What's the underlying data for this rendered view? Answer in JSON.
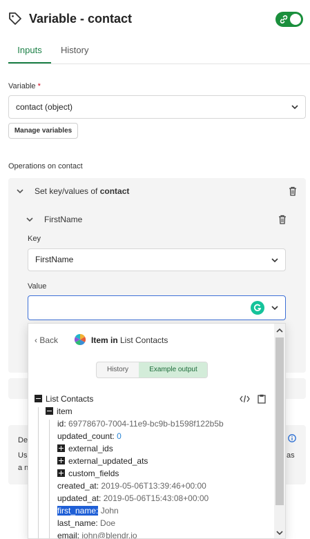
{
  "header": {
    "title": "Variable - contact"
  },
  "tabs": [
    {
      "label": "Inputs"
    },
    {
      "label": "History"
    }
  ],
  "variable": {
    "label": "Variable",
    "required_mark": "*",
    "selected": "contact (object)",
    "manage_label": "Manage variables"
  },
  "operations": {
    "heading": "Operations on contact",
    "set_prefix": "Set key/values of ",
    "set_target": "contact",
    "field_name": "FirstName",
    "key_label": "Key",
    "key_value": "FirstName",
    "value_label": "Value",
    "value_input": ""
  },
  "picker": {
    "back_label": "Back",
    "title_bold": "Item in",
    "title_rest": " List Contacts",
    "seg_history": "History",
    "seg_example": "Example output",
    "tree": {
      "root": "List Contacts",
      "item": "item",
      "id_key": "id:",
      "id_val": "69778670-7004-11e9-bc9b-b1598f122b5b",
      "updated_count_key": "updated_count:",
      "updated_count_val": "0",
      "external_ids": "external_ids",
      "external_updated_ats": "external_updated_ats",
      "custom_fields": "custom_fields",
      "created_at_key": "created_at:",
      "created_at_val": "2019-05-06T13:39:46+00:00",
      "updated_at_key": "updated_at:",
      "updated_at_val": "2019-05-06T15:43:08+00:00",
      "first_name_key": "first_name:",
      "first_name_val": "John",
      "last_name_key": "last_name:",
      "last_name_val": "Doe",
      "email_key": "email:",
      "email_val": "john@blendr.io"
    }
  },
  "description": {
    "label_fragment": "Des",
    "line1_start": "Use",
    "line1_end": "as",
    "line2_start": "a n"
  },
  "colors": {
    "accent_green": "#1a8f3c",
    "active_tab": "#1a7f45",
    "focus_blue": "#3c6fd6",
    "selection_blue": "#1f5fd6",
    "number_blue": "#2a86d6",
    "panel_gray": "#f4f4f4"
  }
}
